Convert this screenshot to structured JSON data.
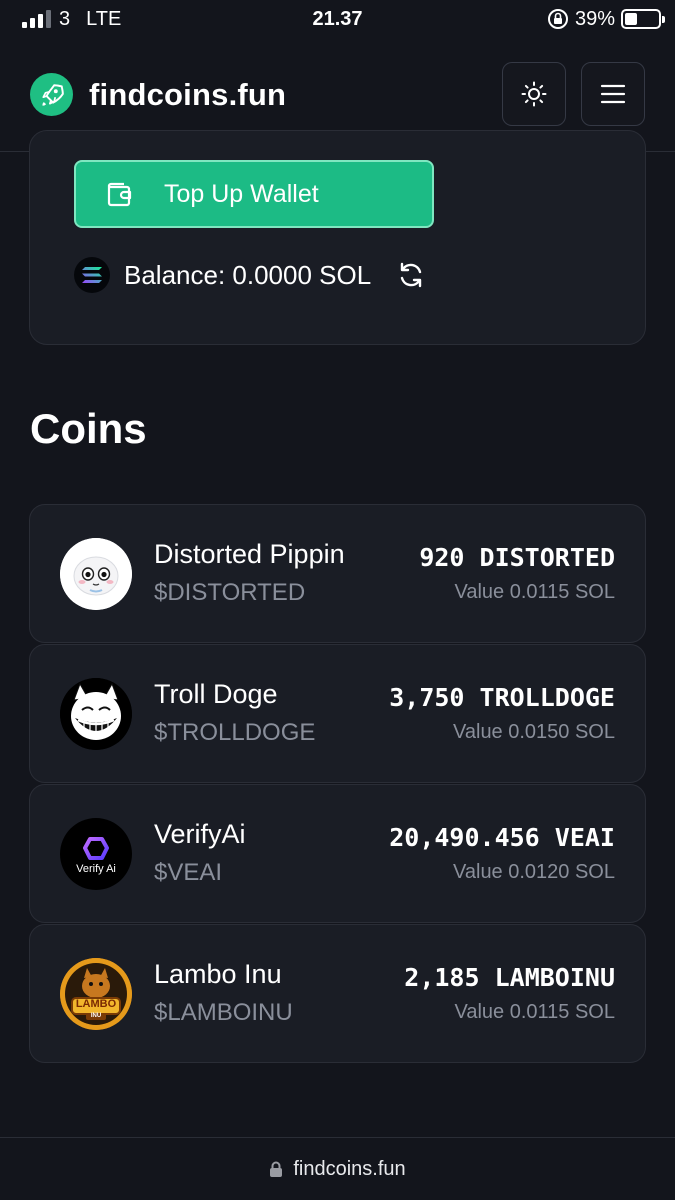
{
  "status_bar": {
    "carrier": "3",
    "network": "LTE",
    "time": "21.37",
    "battery": "39%"
  },
  "header": {
    "brand": "findcoins.fun",
    "logo_icon": "rocket-icon",
    "theme_icon": "sun-icon",
    "menu_icon": "hamburger-icon"
  },
  "wallet": {
    "top_up_label": "Top Up Wallet",
    "top_up_icon": "wallet-icon",
    "balance_text": "Balance: 0.0000 SOL",
    "refresh_icon": "refresh-icon"
  },
  "coins": {
    "title": "Coins",
    "items": [
      {
        "name": "Distorted Pippin",
        "ticker": "$DISTORTED",
        "amount": "920 DISTORTED",
        "value": "Value 0.0115 SOL"
      },
      {
        "name": "Troll Doge",
        "ticker": "$TROLLDOGE",
        "amount": "3,750 TROLLDOGE",
        "value": "Value 0.0150 SOL"
      },
      {
        "name": "VerifyAi",
        "ticker": "$VEAI",
        "amount": "20,490.456 VEAI",
        "value": "Value 0.0120 SOL",
        "logo_text": "Verify Ai"
      },
      {
        "name": "Lambo Inu",
        "ticker": "$LAMBOINU",
        "amount": "2,185 LAMBOINU",
        "value": "Value 0.0115 SOL",
        "logo_text": "LAMBO",
        "logo_subtext": "INU"
      }
    ]
  },
  "url_bar": {
    "url": "findcoins.fun"
  },
  "colors": {
    "background": "#13151c",
    "card": "#1a1d25",
    "accent": "#1cbb85",
    "muted_text": "#8a8f9b"
  }
}
